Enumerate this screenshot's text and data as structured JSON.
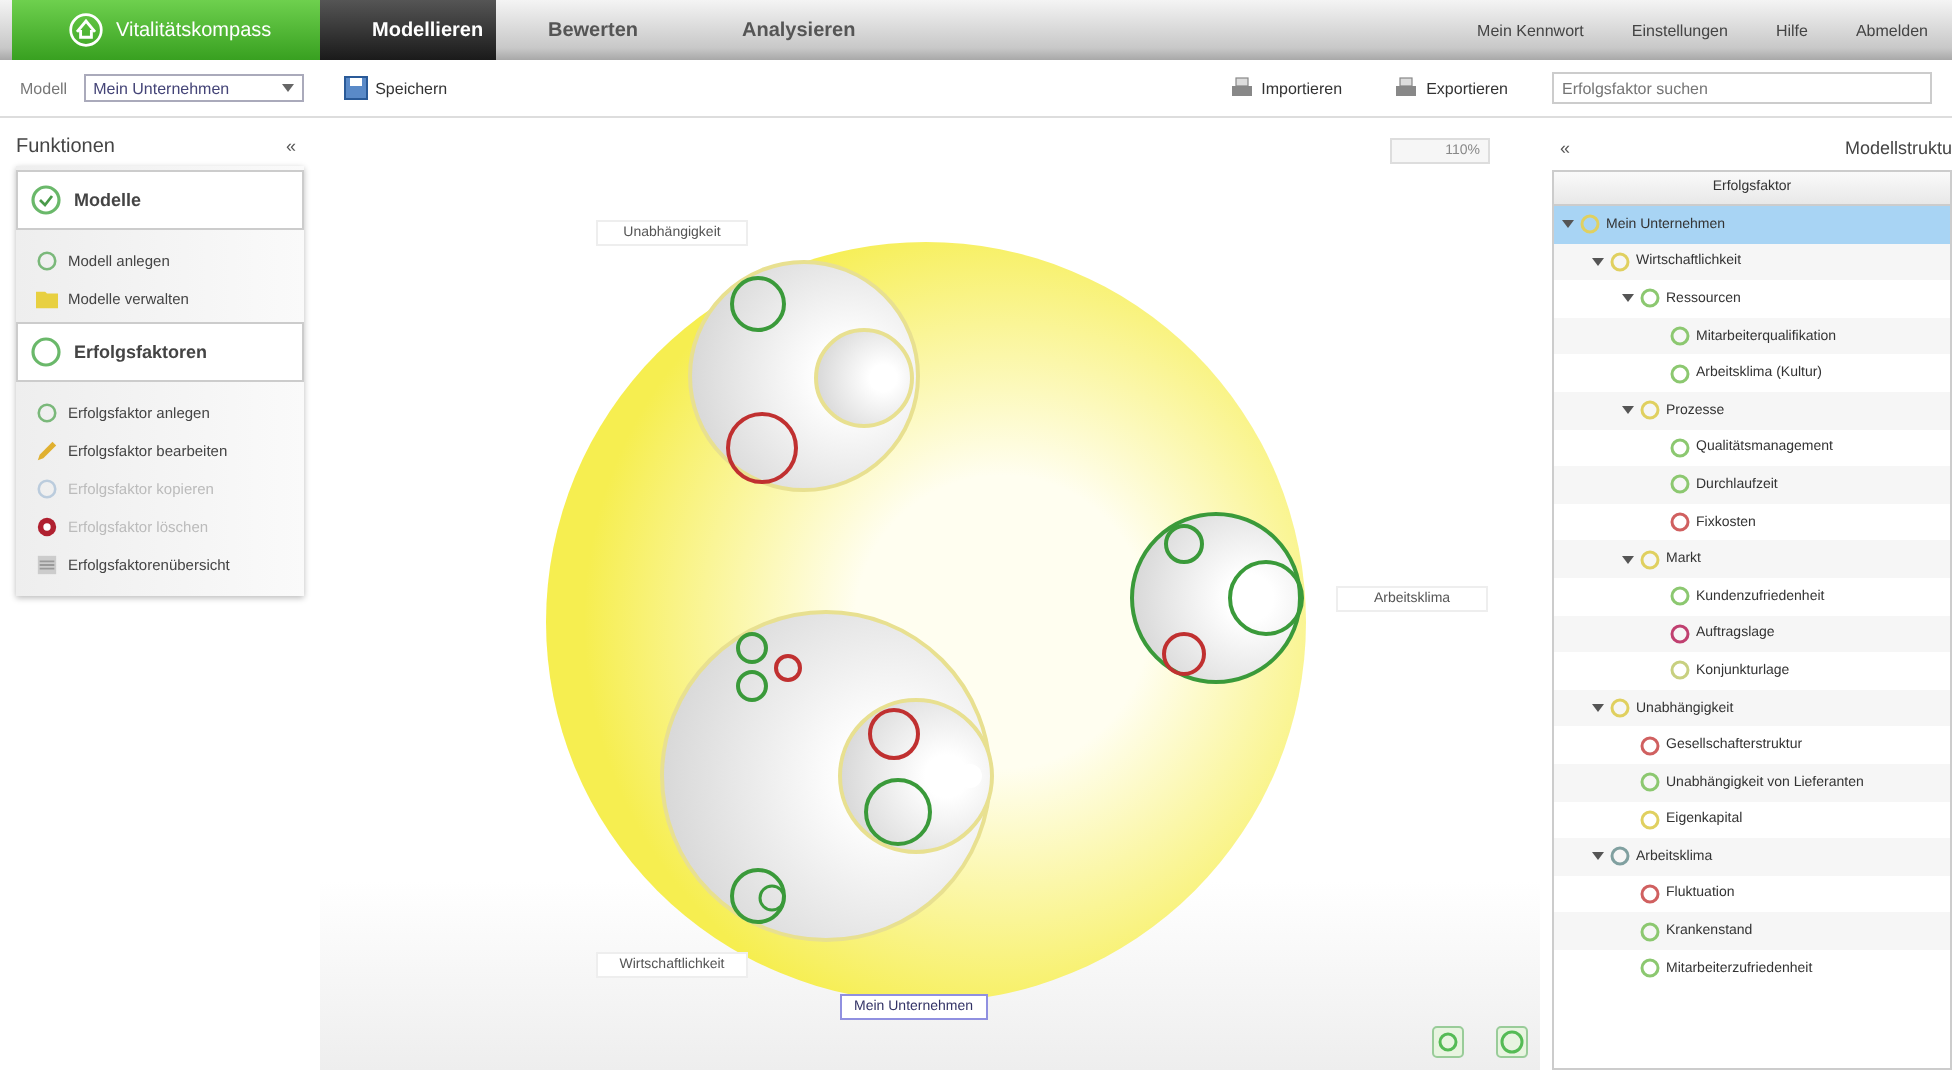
{
  "app": {
    "name": "Vitalitätskompass"
  },
  "tabs": [
    {
      "label": "Modellieren",
      "selected": true
    },
    {
      "label": "Bewerten",
      "selected": false
    },
    {
      "label": "Analysieren",
      "selected": false
    }
  ],
  "user_links": [
    "Mein Kennwort",
    "Einstellungen",
    "Hilfe",
    "Abmelden"
  ],
  "toolbar": {
    "model_label": "Modell",
    "model_value": "Mein Unternehmen",
    "save": "Speichern",
    "import": "Importieren",
    "export": "Exportieren",
    "search": {
      "placeholder": "Erfolgsfaktor suchen"
    }
  },
  "sidebar": {
    "title": "Funktionen",
    "collapse": "«",
    "items": [
      {
        "kind": "section",
        "label": "Modelle"
      },
      {
        "kind": "item",
        "label": "Modell anlegen",
        "disabled": false
      },
      {
        "kind": "item",
        "label": "Modelle verwalten",
        "disabled": false
      },
      {
        "kind": "section",
        "label": "Erfolgsfaktoren"
      },
      {
        "kind": "item",
        "label": "Erfolgsfaktor anlegen",
        "disabled": false
      },
      {
        "kind": "item",
        "label": "Erfolgsfaktor bearbeiten",
        "disabled": false
      },
      {
        "kind": "item",
        "label": "Erfolgsfaktor kopieren",
        "disabled": true
      },
      {
        "kind": "item",
        "label": "Erfolgsfaktor löschen",
        "disabled": true
      },
      {
        "kind": "item",
        "label": "Erfolgsfaktorenübersicht",
        "disabled": false
      }
    ]
  },
  "canvas": {
    "zoom": "110%",
    "labels": [
      "Unabhängigkeit",
      "Arbeitsklima",
      "Wirtschaftlichkeit"
    ],
    "root_label": "Mein Unternehmen"
  },
  "structure": {
    "title": "Modellstruktu",
    "collapse": "«",
    "column": "Erfolgsfaktor",
    "tree": [
      {
        "label": "Mein Unternehmen",
        "color": "#e0d060",
        "selected": true,
        "expanded": true,
        "children": [
          {
            "label": "Wirtschaftlichkeit",
            "color": "#e0d060",
            "selected": false,
            "expanded": true,
            "children": [
              {
                "label": "Ressourcen",
                "color": "#8cc870",
                "selected": false,
                "expanded": true,
                "children": [
                  {
                    "label": "Mitarbeiterqualifikation",
                    "color": "#8cc870",
                    "selected": false
                  },
                  {
                    "label": "Arbeitsklima (Kultur)",
                    "color": "#8cc870",
                    "selected": false
                  }
                ]
              },
              {
                "label": "Prozesse",
                "color": "#e0d060",
                "selected": false,
                "expanded": true,
                "children": [
                  {
                    "label": "Qualitätsmanagement",
                    "color": "#8cc870",
                    "selected": false
                  },
                  {
                    "label": "Durchlaufzeit",
                    "color": "#8cc870",
                    "selected": false
                  },
                  {
                    "label": "Fixkosten",
                    "color": "#d06060",
                    "selected": false
                  }
                ]
              },
              {
                "label": "Markt",
                "color": "#e0d060",
                "selected": false,
                "expanded": true,
                "children": [
                  {
                    "label": "Kundenzufriedenheit",
                    "color": "#8cc870",
                    "selected": false
                  },
                  {
                    "label": "Auftragslage",
                    "color": "#c04070",
                    "selected": false
                  },
                  {
                    "label": "Konjunkturlage",
                    "color": "#c8d080",
                    "selected": false
                  }
                ]
              }
            ]
          },
          {
            "label": "Unabhängigkeit",
            "color": "#e0d060",
            "selected": false,
            "expanded": true,
            "children": [
              {
                "label": "Gesellschafterstruktur",
                "color": "#d06060",
                "selected": false
              },
              {
                "label": "Unabhängigkeit von Lieferanten",
                "color": "#8cc870",
                "selected": false
              },
              {
                "label": "Eigenkapital",
                "color": "#e0d060",
                "selected": false
              }
            ]
          },
          {
            "label": "Arbeitsklima",
            "color": "#80a0a0",
            "selected": false,
            "expanded": true,
            "children": [
              {
                "label": "Fluktuation",
                "color": "#d06060",
                "selected": false
              },
              {
                "label": "Krankenstand",
                "color": "#8cc870",
                "selected": false
              },
              {
                "label": "Mitarbeiterzufriedenheit",
                "color": "#8cc870",
                "selected": false
              }
            ]
          }
        ]
      }
    ]
  }
}
